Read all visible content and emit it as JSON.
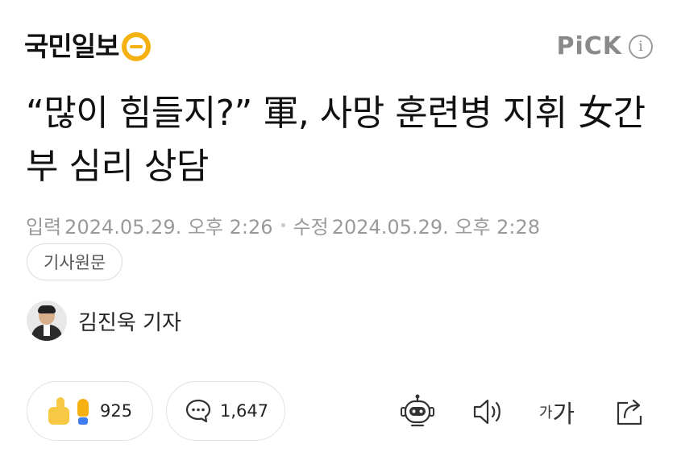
{
  "header": {
    "logo_text": "국민일보",
    "pick_label": "PiCK",
    "info_label": "i"
  },
  "article": {
    "title": "“많이 힘들지?” 軍, 사망 훈련병 지휘 女간부 심리 상담",
    "published_label": "입력",
    "published": "2024.05.29. 오후 2:26",
    "modified_label": "수정",
    "modified": "2024.05.29. 오후 2:28",
    "original_button": "기사원문",
    "author": "김진욱 기자"
  },
  "actions": {
    "reaction_count": "925",
    "comment_count": "1,647",
    "font_small": "가",
    "font_large": "가"
  },
  "colors": {
    "logo_accent": "#f5b111",
    "muted_text": "#9a9a9a"
  }
}
